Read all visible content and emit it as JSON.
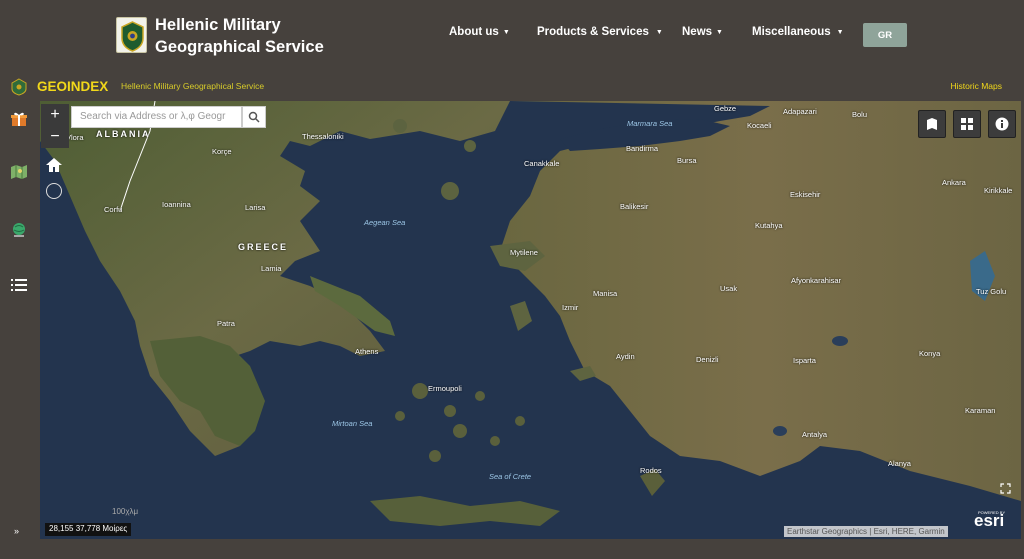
{
  "header": {
    "title_line1": "Hellenic Military",
    "title_line2": "Geographical Service",
    "nav": [
      {
        "label": "About us"
      },
      {
        "label": "Products & Services"
      },
      {
        "label": "News"
      },
      {
        "label": "Miscellaneous"
      }
    ],
    "lang_label": "GR"
  },
  "subheader": {
    "app_name": "GEOINDEX",
    "app_subtitle": "Hellenic Military Geographical Service",
    "historic_link": "Historic Maps"
  },
  "sidebar": {
    "icons": [
      "gift-box-icon",
      "map-layers-icon",
      "globe-icon",
      "list-icon"
    ],
    "expand_label": "»"
  },
  "map": {
    "search_placeholder": "Search via Address or λ,φ Geogr",
    "zoom_in": "+",
    "zoom_out": "−",
    "scale_text": "100χλμ",
    "coords": "28,155 37,778 Μοίρες",
    "attribution": "Earthstar Geographics | Esri, HERE, Garmin",
    "esri_powered": "POWERED BY",
    "esri_logo": "esri",
    "labels": {
      "albania": "ALBANIA",
      "greece": "GREECE",
      "vlora": "Vlora",
      "korce": "Korçe",
      "thessaloniki": "Thessaloniki",
      "ioannina": "Ioannina",
      "corfu": "Corfu",
      "larisa": "Larisa",
      "lamia": "Lamia",
      "patra": "Patra",
      "athens": "Athens",
      "ermoupoli": "Ermoupoli",
      "aegean": "Aegean Sea",
      "myrtoan": "Mirtoan Sea",
      "crete_sea": "Sea of Crete",
      "marmara": "Marmara Sea",
      "gebze": "Gebze",
      "adapazari": "Adapazari",
      "bolu": "Bolu",
      "kocaeli": "Kocaeli",
      "bandirma": "Bandirma",
      "bursa": "Bursa",
      "canakkale": "Canakkale",
      "balikesir": "Balikesir",
      "eskisehir": "Eskisehir",
      "ankara": "Ankara",
      "kirikkale": "Kirikkale",
      "kutahya": "Kutahya",
      "mytilene": "Mytilene",
      "manisa": "Manisa",
      "izmir": "Izmir",
      "usak": "Usak",
      "afyonkarahisar": "Afyonkarahisar",
      "tuz_golu": "Tuz Golu",
      "aydin": "Aydin",
      "denizli": "Denizli",
      "isparta": "Isparta",
      "konya": "Konya",
      "karaman": "Karaman",
      "antalya": "Antalya",
      "alanya": "Alanya",
      "rodos": "Rodos"
    }
  },
  "colors": {
    "header_bg": "#46413d",
    "accent_yellow": "#f2d81a",
    "lang_button": "#8fa49a",
    "sea": "#22344f",
    "land": "#5a6b3e"
  }
}
